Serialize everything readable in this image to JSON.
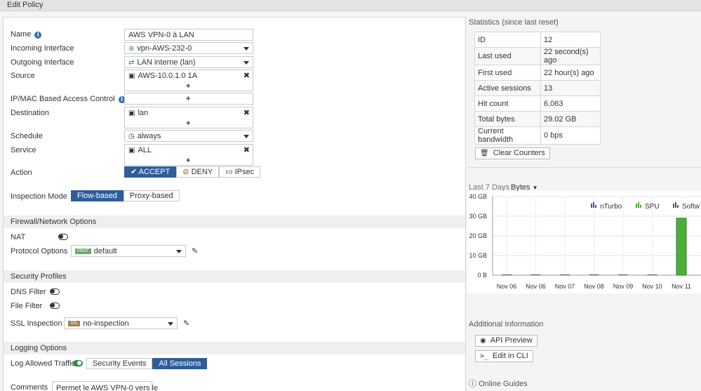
{
  "window": {
    "title": "Edit Policy"
  },
  "form": {
    "name": {
      "label": "Name",
      "value": "AWS VPN-0 à LAN"
    },
    "incoming": {
      "label": "Incoming Interface",
      "value": "vpn-AWS-232-0"
    },
    "outgoing": {
      "label": "Outgoing Interface",
      "value": "LAN interne (lan)"
    },
    "source": {
      "label": "Source",
      "value": "AWS-10.0.1.0 1A"
    },
    "ipmac": {
      "label": "IP/MAC Based Access Control"
    },
    "destination": {
      "label": "Destination",
      "value": "lan"
    },
    "schedule": {
      "label": "Schedule",
      "value": "always"
    },
    "service": {
      "label": "Service",
      "value": "ALL"
    },
    "action": {
      "label": "Action",
      "options": [
        "ACCEPT",
        "DENY",
        "IPsec"
      ]
    },
    "inspection": {
      "label": "Inspection Mode",
      "options": [
        "Flow-based",
        "Proxy-based"
      ]
    }
  },
  "firewall_section": {
    "title": "Firewall/Network Options",
    "nat_label": "NAT",
    "protocol_label": "Protocol Options",
    "protocol_tag": "PROT",
    "protocol_value": "default"
  },
  "security_section": {
    "title": "Security Profiles",
    "dns_label": "DNS Filter",
    "file_label": "File Filter",
    "ssl_label": "SSL Inspection",
    "ssl_tag": "SSL",
    "ssl_value": "no-inspection"
  },
  "logging_section": {
    "title": "Logging Options",
    "log_label": "Log Allowed Traffic",
    "options": [
      "Security Events",
      "All Sessions"
    ]
  },
  "comments": {
    "label": "Comments",
    "value": "Permet le AWS VPN-0 vers le"
  },
  "statistics": {
    "title": "Statistics (since last reset)",
    "rows": [
      {
        "k": "ID",
        "v": "12"
      },
      {
        "k": "Last used",
        "v": "22 second(s) ago"
      },
      {
        "k": "First used",
        "v": "22 hour(s) ago"
      },
      {
        "k": "Active sessions",
        "v": "13"
      },
      {
        "k": "Hit count",
        "v": "6,063"
      },
      {
        "k": "Total bytes",
        "v": "29.02 GB"
      },
      {
        "k": "Current bandwidth",
        "v": "0 bps"
      }
    ],
    "clear_label": "Clear Counters"
  },
  "chart_header": {
    "range": "Last 7 Days",
    "metric": "Bytes"
  },
  "chart_data": {
    "type": "bar",
    "categories": [
      "Nov 06",
      "Nov 06",
      "Nov 07",
      "Nov 08",
      "Nov 09",
      "Nov 10",
      "Nov 11"
    ],
    "series": [
      {
        "name": "nTurbo",
        "values": [
          0,
          0,
          0,
          0,
          0,
          0,
          0
        ]
      },
      {
        "name": "SPU",
        "values": [
          0,
          0,
          0,
          0,
          0,
          0,
          29
        ]
      },
      {
        "name": "Softw",
        "values": [
          0,
          0,
          0,
          0,
          0,
          0,
          0
        ]
      }
    ],
    "yticks": [
      "40 GB",
      "30 GB",
      "20 GB",
      "10 GB",
      "0 B"
    ],
    "ylim": [
      0,
      40
    ],
    "ylabel": "",
    "xlabel": "",
    "colors": {
      "nTurbo": "#2f5d9b",
      "SPU": "#4caf3a",
      "Softw": "#555555"
    },
    "grid": true,
    "legend": "top"
  },
  "additional": {
    "title": "Additional Information",
    "api_label": "API Preview",
    "cli_label": "Edit in CLI",
    "guides_label": "Online Guides"
  }
}
